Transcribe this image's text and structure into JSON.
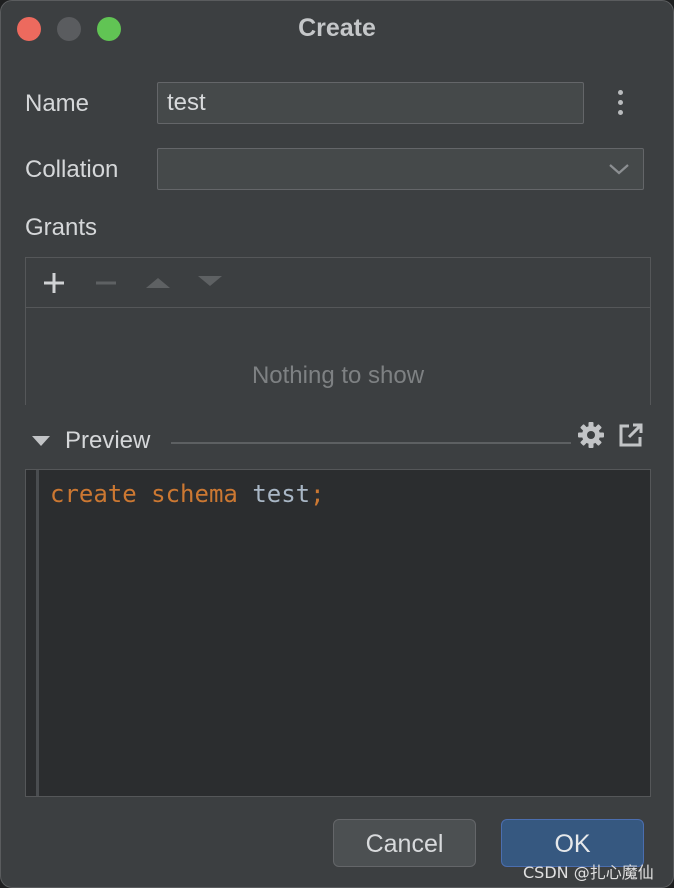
{
  "window": {
    "title": "Create"
  },
  "form": {
    "name_label": "Name",
    "name_value": "test",
    "collation_label": "Collation",
    "collation_value": "",
    "grants_label": "Grants",
    "grants_empty": "Nothing to show"
  },
  "preview": {
    "label": "Preview",
    "code": {
      "kw1": "create",
      "kw2": "schema",
      "ident": "test",
      "semicolon": ";"
    }
  },
  "buttons": {
    "cancel": "Cancel",
    "ok": "OK"
  },
  "watermark": "CSDN @扎心魔仙",
  "icons": [
    "close-traffic-icon",
    "minimize-traffic-icon",
    "maximize-traffic-icon",
    "more-vertical-icon",
    "chevron-down-icon",
    "plus-icon",
    "minus-icon",
    "arrow-up-icon",
    "arrow-down-icon",
    "collapse-triangle-icon",
    "gear-icon",
    "open-external-icon"
  ],
  "colors": {
    "keyword": "#cc7832",
    "identifier": "#a9b7c6",
    "ok_button": "#365880",
    "background": "#3c3f41"
  }
}
